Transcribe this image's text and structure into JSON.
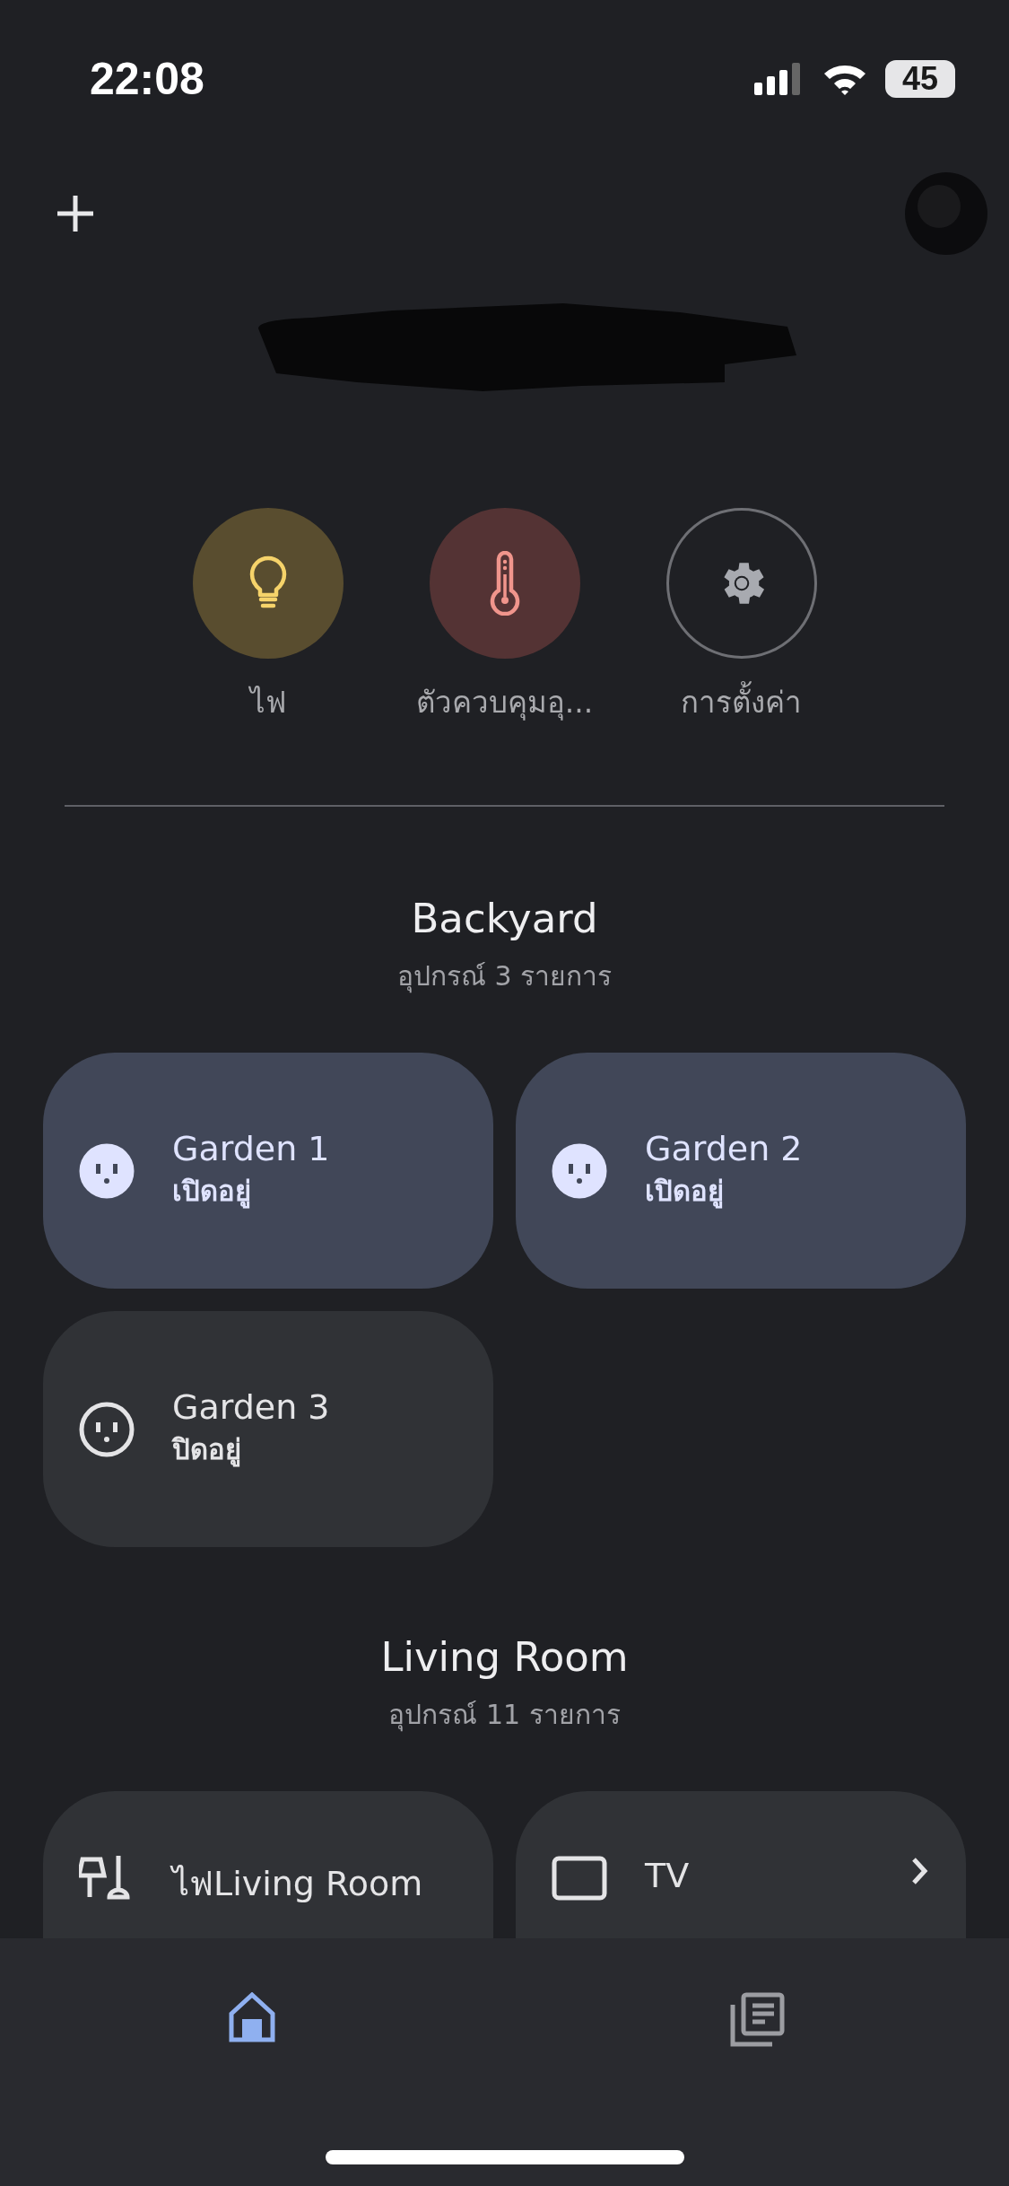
{
  "status_bar": {
    "time": "22:08",
    "battery": "45"
  },
  "quick_actions": [
    {
      "kind": "light",
      "label": "ไฟ"
    },
    {
      "kind": "climate",
      "label": "ตัวควบคุมอุ..."
    },
    {
      "kind": "settings",
      "label": "การตั้งค่า"
    }
  ],
  "rooms": [
    {
      "name": "Backyard",
      "count": "อุปกรณ์ 3 รายการ",
      "devices": [
        {
          "kind": "outlet",
          "name": "Garden 1",
          "status": "เปิดอยู่",
          "on": true,
          "chevron": false
        },
        {
          "kind": "outlet",
          "name": "Garden 2",
          "status": "เปิดอยู่",
          "on": true,
          "chevron": false
        },
        {
          "kind": "outlet",
          "name": "Garden 3",
          "status": "ปิดอยู่",
          "on": false,
          "chevron": false
        }
      ]
    },
    {
      "name": "Living Room",
      "count": "อุปกรณ์ 11 รายการ",
      "devices": [
        {
          "kind": "lamp",
          "name": "ไฟLiving Room",
          "on": false,
          "chevron": false
        },
        {
          "kind": "tv",
          "name": "TV",
          "on": false,
          "chevron": true
        }
      ]
    }
  ],
  "nav": [
    {
      "kind": "home",
      "selected": true
    },
    {
      "kind": "feed",
      "selected": false
    }
  ]
}
